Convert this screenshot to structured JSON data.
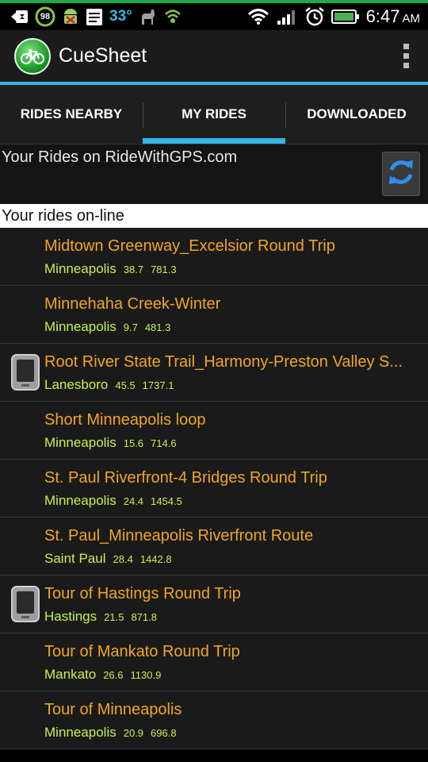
{
  "status_bar": {
    "battery_badge": "98",
    "temperature": "33°",
    "time": "6:47",
    "ampm": "AM",
    "icons": [
      "back-icon",
      "battery-badge-icon",
      "android-debug-icon",
      "notes-icon",
      "temperature",
      "llama-icon",
      "wifi-shield-icon",
      "wifi-icon",
      "signal-icon",
      "alarm-icon",
      "battery-icon"
    ]
  },
  "action_bar": {
    "title": "CueSheet",
    "logo_icon": "bicycle-icon",
    "overflow_icon": "overflow-menu-icon"
  },
  "tabs": [
    {
      "label": "RIDES NEARBY",
      "active": false
    },
    {
      "label": "MY RIDES",
      "active": true
    },
    {
      "label": "DOWNLOADED",
      "active": false
    }
  ],
  "header": {
    "text": "Your Rides on RideWithGPS.com",
    "refresh_icon": "refresh-icon"
  },
  "section_label": "Your rides on-line",
  "rides": [
    {
      "name": "Midtown Greenway_Excelsior Round Trip",
      "city": "Minneapolis",
      "distance": "38.7",
      "elevation": "781.3",
      "downloaded": false
    },
    {
      "name": "Minnehaha Creek-Winter",
      "city": "Minneapolis",
      "distance": "9.7",
      "elevation": "481.3",
      "downloaded": false
    },
    {
      "name": "Root River State Trail_Harmony-Preston Valley S...",
      "city": "Lanesboro",
      "distance": "45.5",
      "elevation": "1737.1",
      "downloaded": true
    },
    {
      "name": "Short Minneapolis loop",
      "city": "Minneapolis",
      "distance": "15.6",
      "elevation": "714.6",
      "downloaded": false
    },
    {
      "name": "St. Paul Riverfront-4 Bridges Round Trip",
      "city": "Minneapolis",
      "distance": "24.4",
      "elevation": "1454.5",
      "downloaded": false
    },
    {
      "name": "St. Paul_Minneapolis Riverfront Route",
      "city": "Saint Paul",
      "distance": "28.4",
      "elevation": "1442.8",
      "downloaded": false
    },
    {
      "name": "Tour of Hastings Round Trip",
      "city": "Hastings",
      "distance": "21.5",
      "elevation": "871.8",
      "downloaded": true
    },
    {
      "name": "Tour of Mankato Round Trip",
      "city": "Mankato",
      "distance": "26.6",
      "elevation": "1130.9",
      "downloaded": false
    },
    {
      "name": "Tour of Minneapolis",
      "city": "Minneapolis",
      "distance": "20.9",
      "elevation": "696.8",
      "downloaded": false
    }
  ],
  "colors": {
    "accent": "#33b5e5",
    "ride_name": "#f0a624",
    "ride_meta": "#c8f050",
    "status_green": "#1ea84a"
  }
}
